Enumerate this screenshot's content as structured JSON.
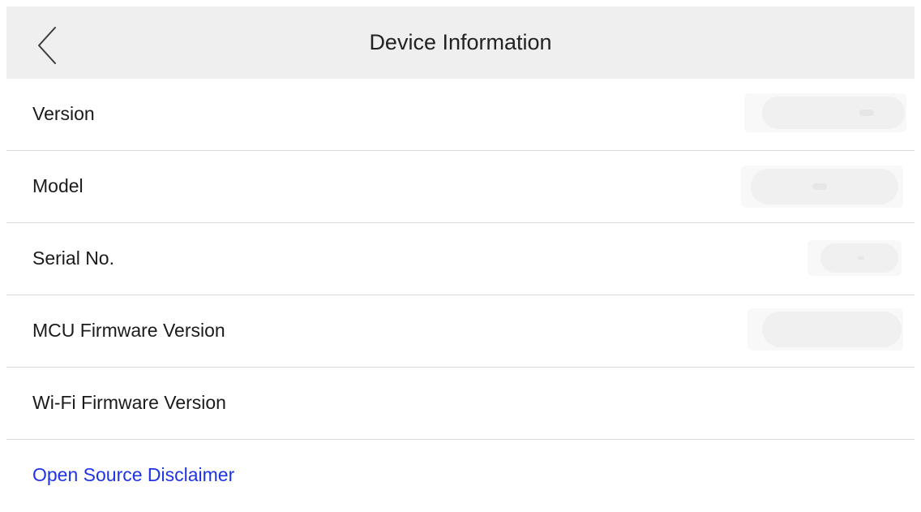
{
  "header": {
    "title": "Device Information",
    "back_icon": "chevron-left-icon"
  },
  "rows": [
    {
      "label": "Version",
      "value": ""
    },
    {
      "label": "Model",
      "value": ""
    },
    {
      "label": "Serial No.",
      "value": ""
    },
    {
      "label": "MCU Firmware Version",
      "value": ""
    },
    {
      "label": "Wi-Fi Firmware Version",
      "value": ""
    }
  ],
  "link": {
    "label": "Open Source Disclaimer",
    "color": "#1f34e6"
  },
  "colors": {
    "header_bg": "#efefef",
    "divider": "#dadada",
    "background": "#ffffff"
  }
}
